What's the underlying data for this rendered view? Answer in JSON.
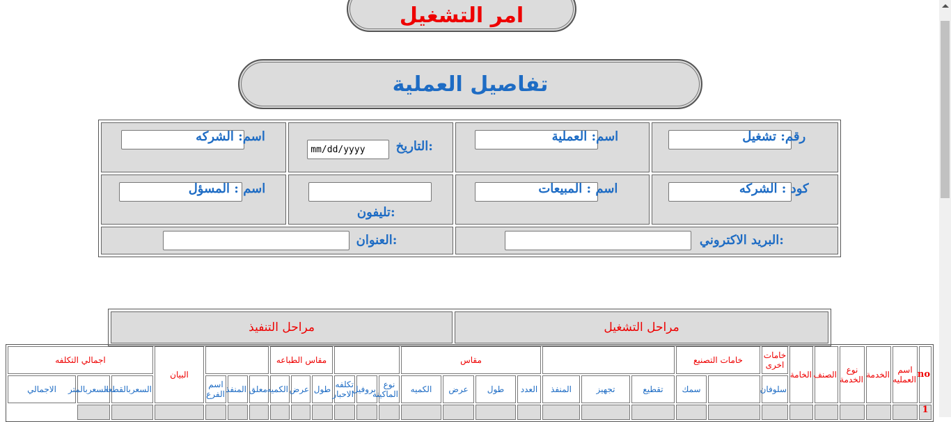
{
  "header": {
    "title": "امر التشغيل",
    "details_title": "تفاصيل العملية"
  },
  "form": {
    "op_number": {
      "label": "رقم: تشغيل",
      "value": ""
    },
    "op_name": {
      "label": "اسم: العملية",
      "value": ""
    },
    "date": {
      "label": "التاريخ:",
      "value": "mm/dd/yyyy"
    },
    "company_name": {
      "label": "اسم: الشركه",
      "value": ""
    },
    "company_code": {
      "label": "كود : الشركه",
      "value": ""
    },
    "sales_name": {
      "label": "اسم : المبيعات",
      "value": ""
    },
    "phone": {
      "label": "تليفون:",
      "value": ""
    },
    "responsible_name": {
      "label": "اسم : المسؤل",
      "value": ""
    },
    "email": {
      "label": "البريد الاكتروني:",
      "value": ""
    },
    "address": {
      "label": "العنوان:",
      "value": ""
    }
  },
  "stages": {
    "operation": "مراحل التشغيل",
    "execution": "مراحل التنفيذ"
  },
  "grid": {
    "h1": {
      "no": "no",
      "op_name": "اسم العمليه",
      "service": "الخدمة",
      "service_type": "نوع الخدمة",
      "category": "الصنف",
      "material": "الخامة",
      "other_materials": "خامات اخرى",
      "mfg_materials": "خامات التصنيع",
      "measure": "مقاس",
      "print_measure": "مقاس الطباعه",
      "statement": "البيان",
      "total_cost": "اجمالي التكلفه"
    },
    "h2": {
      "cellophane": "سلوفان",
      "thickness": "سمك",
      "cutting": "تقطيع",
      "prep": "تجهيز",
      "executor": "المنفذ",
      "count": "العدد",
      "length": "طول",
      "width": "عرض",
      "qty": "الكميه",
      "machine_type": "نوع الماكينه",
      "profile": "بروفيل",
      "ink_cost": "تكلفه الاحبار",
      "p_length": "طول",
      "p_width": "عرض",
      "p_qty": "الكميه",
      "hanging": "معلق",
      "p_executor": "المنفذ",
      "branch_name": "اسم الفرع",
      "price_piece": "السعربالقطعه",
      "price_meter": "السعربالمتر",
      "total": "الاجمالي"
    },
    "first_row_no": "1"
  }
}
